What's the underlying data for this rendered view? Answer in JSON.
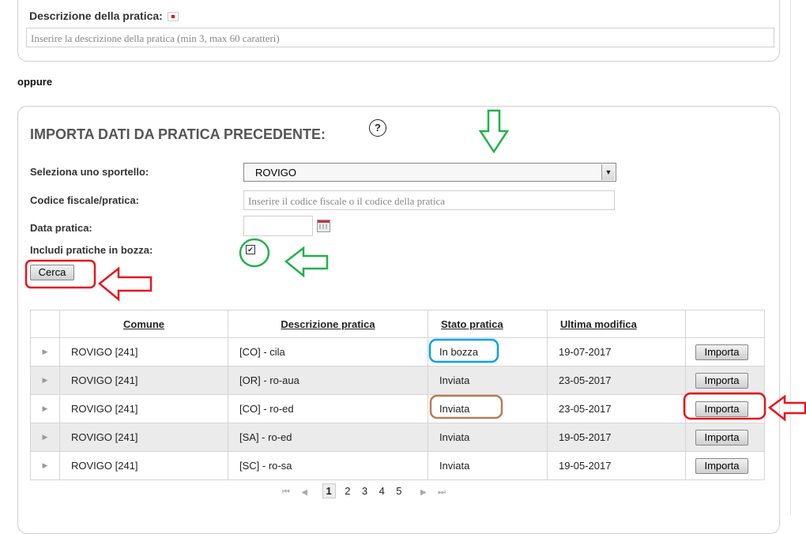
{
  "top_section": {
    "description_label": "Descrizione della pratica:",
    "description_placeholder": "Inserire la descrizione della pratica (min 3, max 60 caratteri)"
  },
  "separator_text": "oppure",
  "import_section": {
    "title": "IMPORTA DATI DA PRATICA PRECEDENTE:",
    "help_glyph": "?",
    "sportello_label": "Seleziona uno sportello:",
    "sportello_value": "ROVIGO",
    "codice_label": "Codice fiscale/pratica:",
    "codice_placeholder": "Inserire il codice fiscale o il codice della pratica",
    "data_label": "Data pratica:",
    "bozza_label": "Includi pratiche in bozza:",
    "bozza_checked": true,
    "search_button": "Cerca"
  },
  "table": {
    "headers": [
      "Comune",
      "Descrizione pratica",
      "Stato pratica",
      "Ultima modifica"
    ],
    "rows": [
      {
        "comune": "ROVIGO [241]",
        "descrizione": "[CO] - cila",
        "stato": "In bozza",
        "modifica": "19-07-2017",
        "action": "Importa"
      },
      {
        "comune": "ROVIGO [241]",
        "descrizione": "[OR] - ro-aua",
        "stato": "Inviata",
        "modifica": "23-05-2017",
        "action": "Importa"
      },
      {
        "comune": "ROVIGO [241]",
        "descrizione": "[CO] - ro-ed",
        "stato": "Inviata",
        "modifica": "23-05-2017",
        "action": "Importa"
      },
      {
        "comune": "ROVIGO [241]",
        "descrizione": "[SA] - ro-ed",
        "stato": "Inviata",
        "modifica": "19-05-2017",
        "action": "Importa"
      },
      {
        "comune": "ROVIGO [241]",
        "descrizione": "[SC] - ro-sa",
        "stato": "Inviata",
        "modifica": "19-05-2017",
        "action": "Importa"
      }
    ]
  },
  "pager": {
    "first": "⏮",
    "prev": "◀",
    "pages": [
      "1",
      "2",
      "3",
      "4",
      "5"
    ],
    "current": "1",
    "next": "▶",
    "last": "⏭"
  },
  "annotation_colors": {
    "green": "#22b14c",
    "red": "#e8141c",
    "blue": "#00a2e8",
    "brown": "#b97a57"
  }
}
